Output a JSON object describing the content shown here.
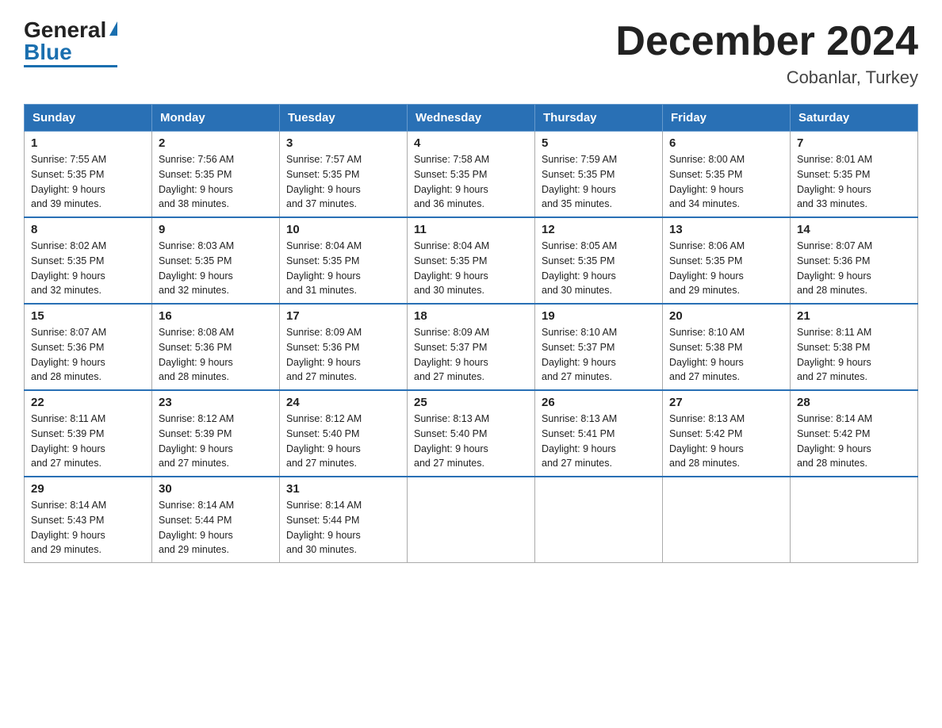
{
  "logo": {
    "general": "General",
    "blue": "Blue"
  },
  "header": {
    "month": "December 2024",
    "location": "Cobanlar, Turkey"
  },
  "weekdays": [
    "Sunday",
    "Monday",
    "Tuesday",
    "Wednesday",
    "Thursday",
    "Friday",
    "Saturday"
  ],
  "weeks": [
    [
      {
        "day": "1",
        "sunrise": "7:55 AM",
        "sunset": "5:35 PM",
        "daylight": "9 hours and 39 minutes."
      },
      {
        "day": "2",
        "sunrise": "7:56 AM",
        "sunset": "5:35 PM",
        "daylight": "9 hours and 38 minutes."
      },
      {
        "day": "3",
        "sunrise": "7:57 AM",
        "sunset": "5:35 PM",
        "daylight": "9 hours and 37 minutes."
      },
      {
        "day": "4",
        "sunrise": "7:58 AM",
        "sunset": "5:35 PM",
        "daylight": "9 hours and 36 minutes."
      },
      {
        "day": "5",
        "sunrise": "7:59 AM",
        "sunset": "5:35 PM",
        "daylight": "9 hours and 35 minutes."
      },
      {
        "day": "6",
        "sunrise": "8:00 AM",
        "sunset": "5:35 PM",
        "daylight": "9 hours and 34 minutes."
      },
      {
        "day": "7",
        "sunrise": "8:01 AM",
        "sunset": "5:35 PM",
        "daylight": "9 hours and 33 minutes."
      }
    ],
    [
      {
        "day": "8",
        "sunrise": "8:02 AM",
        "sunset": "5:35 PM",
        "daylight": "9 hours and 32 minutes."
      },
      {
        "day": "9",
        "sunrise": "8:03 AM",
        "sunset": "5:35 PM",
        "daylight": "9 hours and 32 minutes."
      },
      {
        "day": "10",
        "sunrise": "8:04 AM",
        "sunset": "5:35 PM",
        "daylight": "9 hours and 31 minutes."
      },
      {
        "day": "11",
        "sunrise": "8:04 AM",
        "sunset": "5:35 PM",
        "daylight": "9 hours and 30 minutes."
      },
      {
        "day": "12",
        "sunrise": "8:05 AM",
        "sunset": "5:35 PM",
        "daylight": "9 hours and 30 minutes."
      },
      {
        "day": "13",
        "sunrise": "8:06 AM",
        "sunset": "5:35 PM",
        "daylight": "9 hours and 29 minutes."
      },
      {
        "day": "14",
        "sunrise": "8:07 AM",
        "sunset": "5:36 PM",
        "daylight": "9 hours and 28 minutes."
      }
    ],
    [
      {
        "day": "15",
        "sunrise": "8:07 AM",
        "sunset": "5:36 PM",
        "daylight": "9 hours and 28 minutes."
      },
      {
        "day": "16",
        "sunrise": "8:08 AM",
        "sunset": "5:36 PM",
        "daylight": "9 hours and 28 minutes."
      },
      {
        "day": "17",
        "sunrise": "8:09 AM",
        "sunset": "5:36 PM",
        "daylight": "9 hours and 27 minutes."
      },
      {
        "day": "18",
        "sunrise": "8:09 AM",
        "sunset": "5:37 PM",
        "daylight": "9 hours and 27 minutes."
      },
      {
        "day": "19",
        "sunrise": "8:10 AM",
        "sunset": "5:37 PM",
        "daylight": "9 hours and 27 minutes."
      },
      {
        "day": "20",
        "sunrise": "8:10 AM",
        "sunset": "5:38 PM",
        "daylight": "9 hours and 27 minutes."
      },
      {
        "day": "21",
        "sunrise": "8:11 AM",
        "sunset": "5:38 PM",
        "daylight": "9 hours and 27 minutes."
      }
    ],
    [
      {
        "day": "22",
        "sunrise": "8:11 AM",
        "sunset": "5:39 PM",
        "daylight": "9 hours and 27 minutes."
      },
      {
        "day": "23",
        "sunrise": "8:12 AM",
        "sunset": "5:39 PM",
        "daylight": "9 hours and 27 minutes."
      },
      {
        "day": "24",
        "sunrise": "8:12 AM",
        "sunset": "5:40 PM",
        "daylight": "9 hours and 27 minutes."
      },
      {
        "day": "25",
        "sunrise": "8:13 AM",
        "sunset": "5:40 PM",
        "daylight": "9 hours and 27 minutes."
      },
      {
        "day": "26",
        "sunrise": "8:13 AM",
        "sunset": "5:41 PM",
        "daylight": "9 hours and 27 minutes."
      },
      {
        "day": "27",
        "sunrise": "8:13 AM",
        "sunset": "5:42 PM",
        "daylight": "9 hours and 28 minutes."
      },
      {
        "day": "28",
        "sunrise": "8:14 AM",
        "sunset": "5:42 PM",
        "daylight": "9 hours and 28 minutes."
      }
    ],
    [
      {
        "day": "29",
        "sunrise": "8:14 AM",
        "sunset": "5:43 PM",
        "daylight": "9 hours and 29 minutes."
      },
      {
        "day": "30",
        "sunrise": "8:14 AM",
        "sunset": "5:44 PM",
        "daylight": "9 hours and 29 minutes."
      },
      {
        "day": "31",
        "sunrise": "8:14 AM",
        "sunset": "5:44 PM",
        "daylight": "9 hours and 30 minutes."
      },
      null,
      null,
      null,
      null
    ]
  ],
  "labels": {
    "sunrise": "Sunrise:",
    "sunset": "Sunset:",
    "daylight": "Daylight:"
  }
}
